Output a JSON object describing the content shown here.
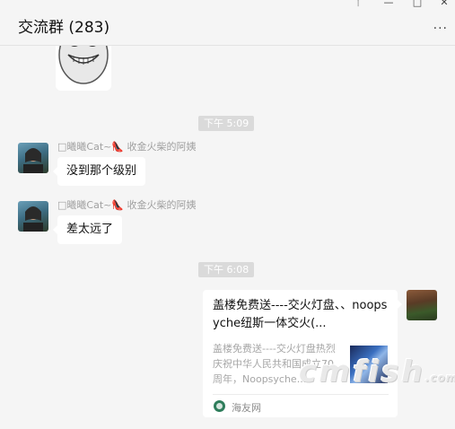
{
  "header": {
    "title": "交流群 (283)",
    "pin_glyph": "ᛉ",
    "min_glyph": "—",
    "max_glyph": "□",
    "close_glyph": "✕",
    "more_glyph": "···"
  },
  "messages": [
    {
      "type": "sticker",
      "icon": "face-sticker"
    },
    {
      "type": "time",
      "text": "下午 5:09"
    },
    {
      "type": "text",
      "sender": "□曦曦Cat~👠 收金火柴的阿姨",
      "text": "没到那个级别"
    },
    {
      "type": "text",
      "sender": "□曦曦Cat~👠 收金火柴的阿姨",
      "text": "差太远了"
    },
    {
      "type": "time",
      "text": "下午 6:08"
    },
    {
      "type": "link",
      "title": "盖楼免费送----交火灯盘、、noopsyche纽斯一体交火(...",
      "description": "盖楼免费送----交火灯盘热烈庆祝中华人民共和国成立70周年，Noopsyche...",
      "source": "海友网"
    }
  ],
  "watermark": {
    "main": "cmfish",
    "suffix": ".com"
  }
}
